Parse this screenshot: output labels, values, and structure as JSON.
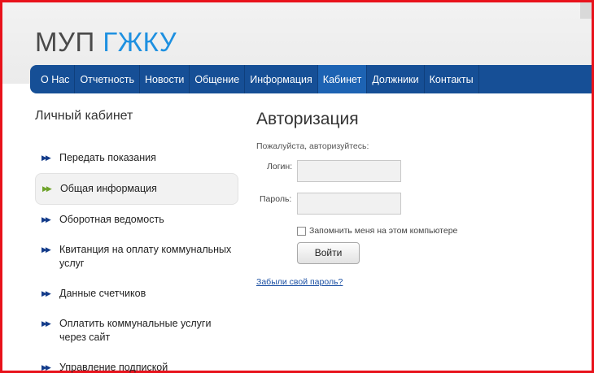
{
  "logo": {
    "part1": "МУП",
    "part2": "ГЖКУ"
  },
  "nav": [
    {
      "label": "О Нас"
    },
    {
      "label": "Отчетность"
    },
    {
      "label": "Новости"
    },
    {
      "label": "Общение"
    },
    {
      "label": "Информация"
    },
    {
      "label": "Кабинет",
      "active": true
    },
    {
      "label": "Должники"
    },
    {
      "label": "Контакты"
    }
  ],
  "sidebar": {
    "title": "Личный кабинет",
    "items": [
      {
        "label": "Передать показания"
      },
      {
        "label": "Общая информация",
        "selected": true
      },
      {
        "label": "Оборотная ведомость"
      },
      {
        "label": "Квитанция на оплату коммунальных услуг"
      },
      {
        "label": "Данные счетчиков"
      },
      {
        "label": "Оплатить коммунальные услуги через сайт"
      },
      {
        "label": "Управление подпиской"
      }
    ]
  },
  "auth": {
    "title": "Авторизация",
    "prompt": "Пожалуйста, авторизуйтесь:",
    "login_label": "Логин:",
    "login_value": "",
    "password_label": "Пароль:",
    "password_value": "",
    "remember_label": "Запомнить меня на этом компьютере",
    "submit_label": "Войти",
    "forgot_link": "Забыли свой пароль?"
  },
  "colors": {
    "nav_bg": "#164f96",
    "nav_active": "#1d63b3",
    "logo_accent": "#1e90e0",
    "frame_border": "#e8121b"
  }
}
